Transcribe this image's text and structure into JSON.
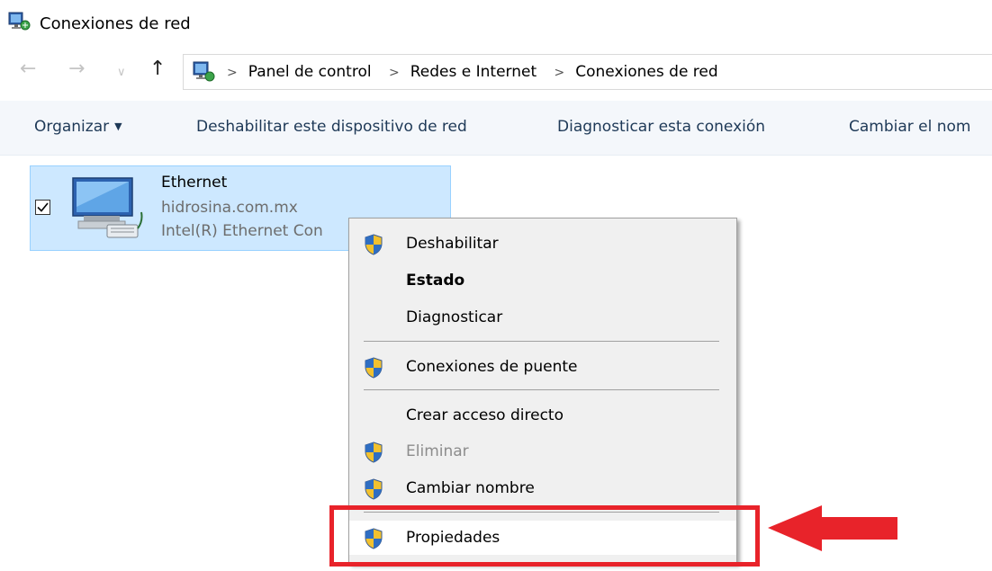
{
  "window": {
    "title": "Conexiones de red"
  },
  "nav": {
    "back": "←",
    "forward": "→",
    "recent": "∨",
    "up": "↑"
  },
  "breadcrumb": {
    "separator": ">",
    "items": [
      "Panel de control",
      "Redes e Internet",
      "Conexiones de red"
    ]
  },
  "commands": {
    "organize": "Organizar",
    "disable_device": "Deshabilitar este dispositivo de red",
    "diagnose": "Diagnosticar esta conexión",
    "rename": "Cambiar el nom"
  },
  "connection": {
    "name": "Ethernet",
    "domain": "hidrosina.com.mx",
    "adapter": "Intel(R) Ethernet Con"
  },
  "context_menu": {
    "items": [
      {
        "label": "Deshabilitar",
        "icon": "uac-shield-icon"
      },
      {
        "label": "Estado"
      },
      {
        "label": "Diagnosticar"
      },
      {
        "label": "Conexiones de puente",
        "icon": "uac-shield-icon"
      },
      {
        "label": "Crear acceso directo"
      },
      {
        "label": "Eliminar",
        "icon": "uac-shield-icon",
        "state": "disabled"
      },
      {
        "label": "Cambiar nombre",
        "icon": "uac-shield-icon"
      },
      {
        "label": "Propiedades",
        "icon": "uac-shield-icon",
        "state": "highlighted"
      }
    ]
  },
  "colors": {
    "selection_bg": "#cde8ff",
    "selection_border": "#99d1ff",
    "command_text": "#1e3957",
    "annotation_red": "#e8232a"
  }
}
